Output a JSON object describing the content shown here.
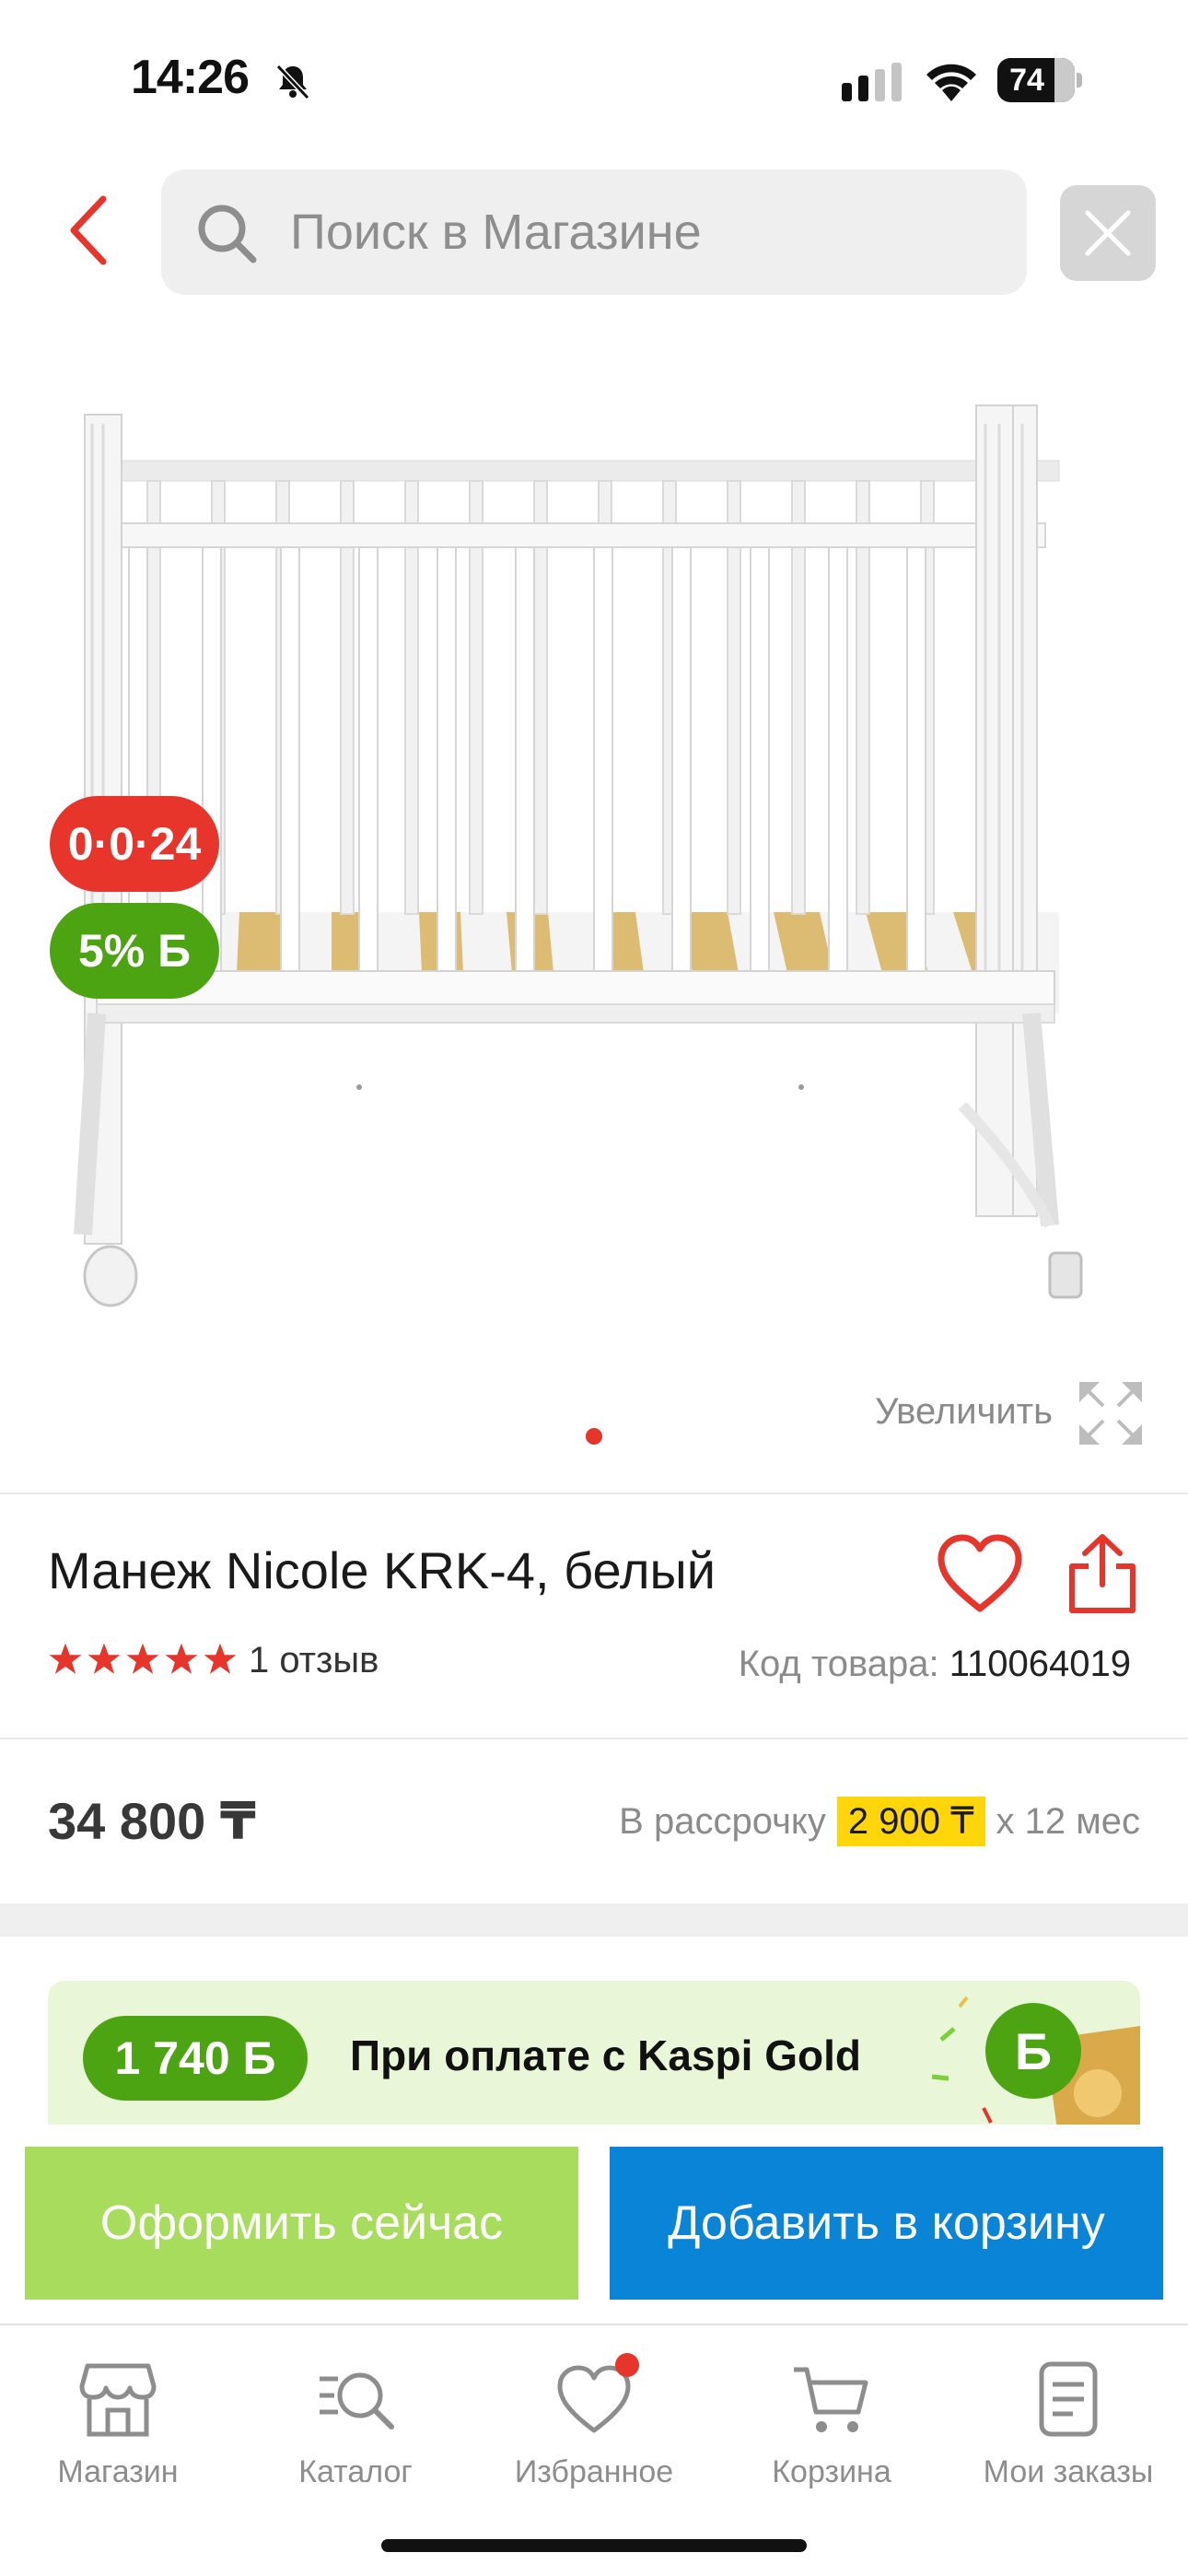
{
  "status_bar": {
    "time": "14:26",
    "battery": "74"
  },
  "search": {
    "placeholder": "Поиск в Магазине"
  },
  "badges": {
    "installment": "0·0·24",
    "bonus": "5% Б"
  },
  "gallery": {
    "zoom_label": "Увеличить"
  },
  "product": {
    "title": "Манеж Nicole KRK-4, белый",
    "rating": 5,
    "reviews": "1 отзыв",
    "sku_label": "Код товара:",
    "sku_value": "110064019"
  },
  "pricing": {
    "price": "34 800 ₸",
    "installment_prefix": "В рассрочку",
    "installment_amount": "2 900 ₸",
    "installment_suffix": "x 12 мес"
  },
  "promo": {
    "bonus": "1 740 Б",
    "text": "При оплате с Kaspi Gold"
  },
  "actions": {
    "buy_now": "Оформить сейчас",
    "add_to_cart": "Добавить в корзину"
  },
  "tabs": [
    {
      "label": "Магазин",
      "icon": "shop-icon"
    },
    {
      "label": "Каталог",
      "icon": "catalog-search-icon"
    },
    {
      "label": "Избранное",
      "icon": "heart-icon"
    },
    {
      "label": "Корзина",
      "icon": "cart-icon"
    },
    {
      "label": "Мои заказы",
      "icon": "orders-icon"
    }
  ],
  "colors": {
    "accent_red": "#e8352b",
    "bonus_green": "#4ca412",
    "buy_green": "#a8dc5c",
    "cart_blue": "#0a84d6",
    "installment_yellow": "#ffd60a"
  }
}
